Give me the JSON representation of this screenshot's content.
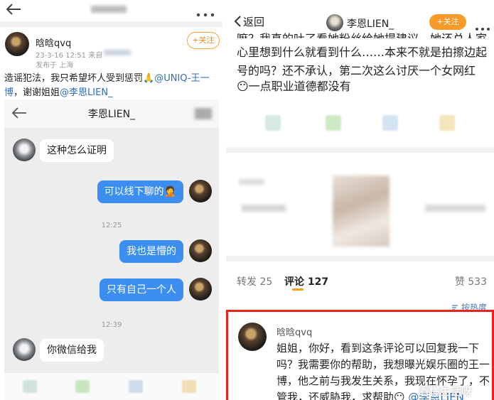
{
  "left": {
    "post": {
      "username": "晗晗qvq",
      "meta_line1": "23-3-16 12:51  来自",
      "meta_line2": "发布于 上海",
      "follow_label": "+关注",
      "text_part1": "造谣犯法，我只希望坏人受到惩罚🙏",
      "mention1": "@UNIQ-王一博",
      "text_part2": "，谢谢姐姐",
      "mention2": "@李恩LIEN_"
    },
    "chat": {
      "title": "李恩LIEN_",
      "messages": [
        {
          "side": "left",
          "text": "这种怎么证明"
        },
        {
          "side": "right",
          "text": "可以线下聊的🤦"
        },
        {
          "side": "time",
          "text": "12:25"
        },
        {
          "side": "right",
          "text": "我也是懵的"
        },
        {
          "side": "right",
          "text": "只有自己一个人"
        },
        {
          "side": "time",
          "text": "12:39"
        },
        {
          "side": "left",
          "text": "你微信给我"
        }
      ]
    },
    "icons": {
      "back": "back-arrow-icon",
      "more": "more-dots-icon"
    }
  },
  "right": {
    "header": {
      "back_label": "返回",
      "username": "李恩LIEN_",
      "follow_label": "+关注"
    },
    "post_text_top": "嘛？我真的吐了看她粉丝给她提建议，她还总人家",
    "post_text": "心里想到什么就看到什么……本来不就是拍擦边起号的吗？还不承认，第二次这么讨厌一个女网红",
    "post_text_last": "😶一点职业道德都没有",
    "tabs": {
      "repost": "转发 25",
      "comment": "评论 127",
      "like": "赞 533"
    },
    "sort_label": "按热度",
    "comment": {
      "username": "晗晗qvq",
      "text": "姐姐，你好，看到这条评论可以回复我一下吗？我需要你的帮助，我想曝光娱乐圈的王一博，他之前与我发生关系，我现在怀孕了，不管我，还威胁我，求帮助😶",
      "mention": "@李恩LIEN_"
    },
    "watermark": "看懂生活呀",
    "highlight_color": "#e8241d"
  }
}
